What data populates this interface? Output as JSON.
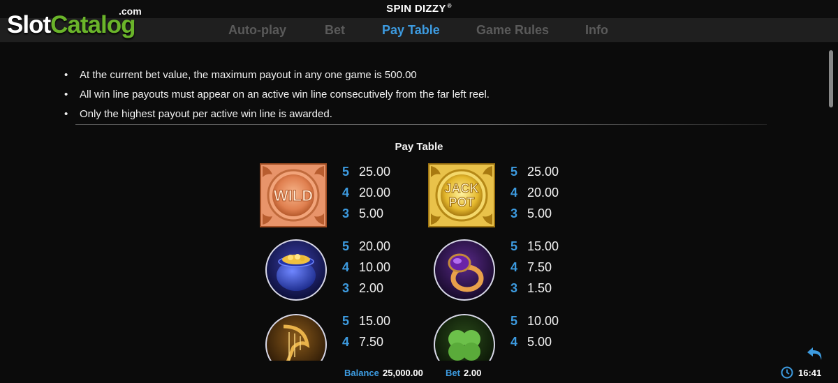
{
  "header": {
    "title": "SPIN DIZZY",
    "registered_mark": "®",
    "tabs": [
      {
        "label": "Auto-play"
      },
      {
        "label": "Bet"
      },
      {
        "label": "Pay Table"
      },
      {
        "label": "Game Rules"
      },
      {
        "label": "Info"
      }
    ],
    "active_tab": "Pay Table"
  },
  "watermark": {
    "slot": "Slot",
    "catalog": "Catalog",
    "com": ".com"
  },
  "rules": [
    "At the current bet value, the maximum payout in any one game is 500.00",
    "All win line payouts must appear on an active win line consecutively from the far left reel.",
    "Only the highest payout per active win line is awarded."
  ],
  "paytable": {
    "title": "Pay Table",
    "symbols": [
      {
        "name": "wild",
        "icon": "wild-symbol-icon",
        "text": "WILD",
        "pays": [
          {
            "count": "5",
            "value": "25.00"
          },
          {
            "count": "4",
            "value": "20.00"
          },
          {
            "count": "3",
            "value": "5.00"
          }
        ]
      },
      {
        "name": "jackpot",
        "icon": "jackpot-symbol-icon",
        "text_top": "JACK",
        "text_bottom": "POT",
        "pays": [
          {
            "count": "5",
            "value": "25.00"
          },
          {
            "count": "4",
            "value": "20.00"
          },
          {
            "count": "3",
            "value": "5.00"
          }
        ]
      },
      {
        "name": "pot-of-gold",
        "icon": "pot-of-gold-icon",
        "pays": [
          {
            "count": "5",
            "value": "20.00"
          },
          {
            "count": "4",
            "value": "10.00"
          },
          {
            "count": "3",
            "value": "2.00"
          }
        ]
      },
      {
        "name": "ring",
        "icon": "gold-ring-icon",
        "pays": [
          {
            "count": "5",
            "value": "15.00"
          },
          {
            "count": "4",
            "value": "7.50"
          },
          {
            "count": "3",
            "value": "1.50"
          }
        ]
      },
      {
        "name": "harp",
        "icon": "harp-icon",
        "pays": [
          {
            "count": "5",
            "value": "15.00"
          },
          {
            "count": "4",
            "value": "7.50"
          }
        ]
      },
      {
        "name": "clover",
        "icon": "clover-icon",
        "pays": [
          {
            "count": "5",
            "value": "10.00"
          },
          {
            "count": "4",
            "value": "5.00"
          }
        ]
      }
    ]
  },
  "footer": {
    "balance_label": "Balance",
    "balance_value": "25,000.00",
    "bet_label": "Bet",
    "bet_value": "2.00",
    "time": "16:41"
  },
  "colors": {
    "accent": "#3d9be0",
    "logo_green": "#6ab42a",
    "background": "#0b0b0b"
  }
}
